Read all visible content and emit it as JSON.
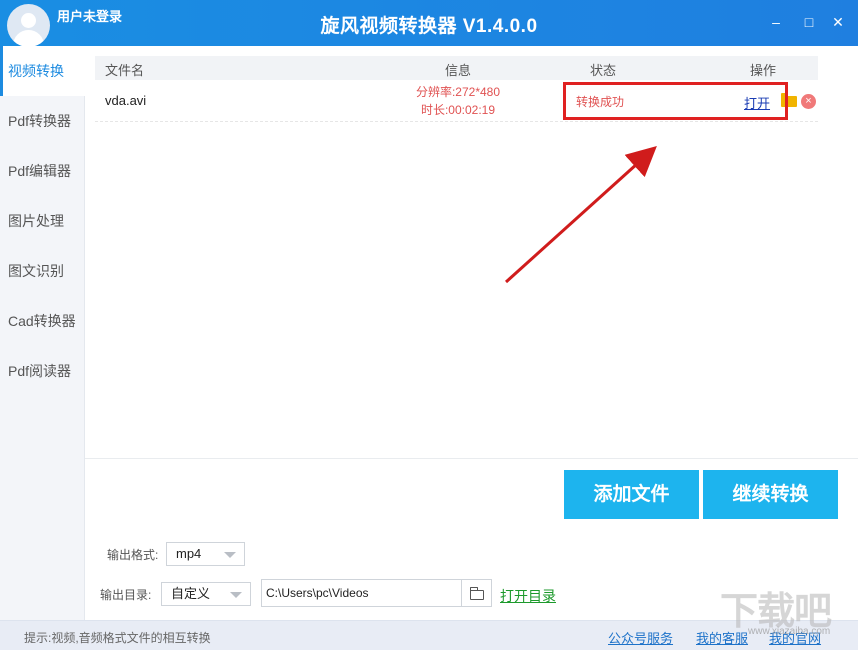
{
  "titlebar": {
    "user": "用户未登录",
    "title": "旋风视频转换器 V1.4.0.0",
    "minimize": "–",
    "maximize": "□",
    "close": "✕"
  },
  "sidebar": {
    "items": [
      {
        "label": "视频转换"
      },
      {
        "label": "Pdf转换器"
      },
      {
        "label": "Pdf编辑器"
      },
      {
        "label": "图片处理"
      },
      {
        "label": "图文识别"
      },
      {
        "label": "Cad转换器"
      },
      {
        "label": "Pdf阅读器"
      }
    ]
  },
  "table": {
    "headers": {
      "filename": "文件名",
      "info": "信息",
      "status": "状态",
      "action": "操作"
    },
    "rows": [
      {
        "filename": "vda.avi",
        "resolution": "分辨率:272*480",
        "duration": "时长:00:02:19",
        "status": "转换成功",
        "open": "打开"
      }
    ]
  },
  "buttons": {
    "add_file": "添加文件",
    "continue": "继续转换"
  },
  "output": {
    "format_label": "输出格式:",
    "format_value": "mp4",
    "dir_label": "输出目录:",
    "dir_mode": "自定义",
    "dir_path": "C:\\Users\\pc\\Videos",
    "open_dir": "打开目录"
  },
  "statusbar": {
    "tip": "提示:视频,音频格式文件的相互转换",
    "links": [
      "公众号服务",
      "我的客服",
      "我的官网"
    ]
  },
  "watermark": {
    "text": "下载吧",
    "sub": "www.xiazaiba.com"
  },
  "colors": {
    "accent": "#1d8be0",
    "button": "#1db4ee",
    "status_ok": "#e05252",
    "highlight": "#e02121"
  }
}
